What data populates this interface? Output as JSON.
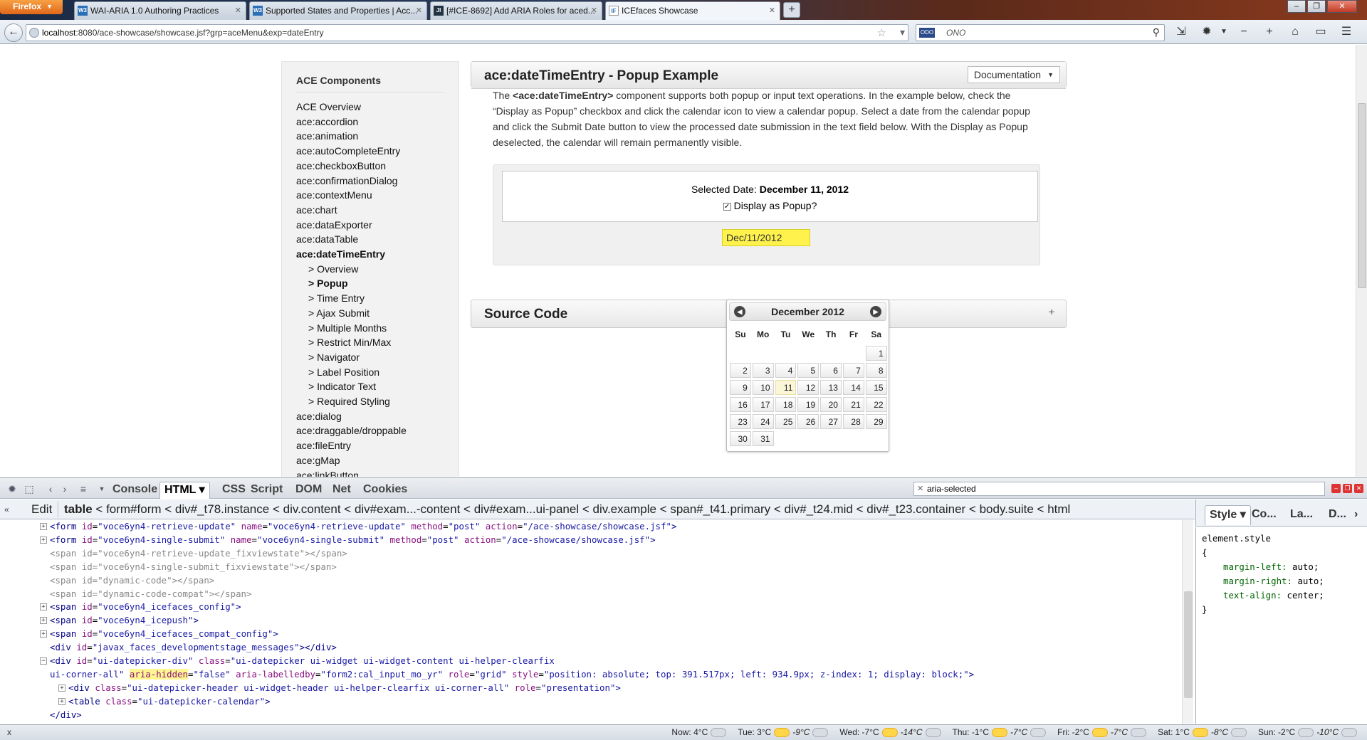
{
  "browser": {
    "menu_label": "Firefox",
    "tabs": [
      {
        "favicon": "W3",
        "label": "WAI-ARIA 1.0 Authoring Practices",
        "active": false
      },
      {
        "favicon": "W3",
        "label": "Supported States and Properties | Acc...",
        "active": false
      },
      {
        "favicon": "JI",
        "label": "[#ICE-8692] Add ARIA Roles for aced...",
        "active": false
      },
      {
        "favicon": "IF",
        "label": "ICEfaces Showcase",
        "active": true
      }
    ],
    "url_host": "localhost",
    "url_rest": ":8080/ace-showcase/showcase.jsf?grp=aceMenu&exp=dateEntry",
    "search_engine": "ODO",
    "search_text": "ONO"
  },
  "sidebar": {
    "title": "ACE Components",
    "items": [
      {
        "label": "ACE Overview",
        "level": 0,
        "bold": false
      },
      {
        "label": "ace:accordion",
        "level": 0,
        "bold": false
      },
      {
        "label": "ace:animation",
        "level": 0,
        "bold": false
      },
      {
        "label": "ace:autoCompleteEntry",
        "level": 0,
        "bold": false
      },
      {
        "label": "ace:checkboxButton",
        "level": 0,
        "bold": false
      },
      {
        "label": "ace:confirmationDialog",
        "level": 0,
        "bold": false
      },
      {
        "label": "ace:contextMenu",
        "level": 0,
        "bold": false
      },
      {
        "label": "ace:chart",
        "level": 0,
        "bold": false
      },
      {
        "label": "ace:dataExporter",
        "level": 0,
        "bold": false
      },
      {
        "label": "ace:dataTable",
        "level": 0,
        "bold": false
      },
      {
        "label": "ace:dateTimeEntry",
        "level": 0,
        "bold": true
      },
      {
        "label": "> Overview",
        "level": 1,
        "bold": false
      },
      {
        "label": "> Popup",
        "level": 1,
        "bold": true
      },
      {
        "label": "> Time Entry",
        "level": 1,
        "bold": false
      },
      {
        "label": "> Ajax Submit",
        "level": 1,
        "bold": false
      },
      {
        "label": "> Multiple Months",
        "level": 1,
        "bold": false
      },
      {
        "label": "> Restrict Min/Max",
        "level": 1,
        "bold": false
      },
      {
        "label": "> Navigator",
        "level": 1,
        "bold": false
      },
      {
        "label": "> Label Position",
        "level": 1,
        "bold": false
      },
      {
        "label": "> Indicator Text",
        "level": 1,
        "bold": false
      },
      {
        "label": "> Required Styling",
        "level": 1,
        "bold": false
      },
      {
        "label": "ace:dialog",
        "level": 0,
        "bold": false
      },
      {
        "label": "ace:draggable/droppable",
        "level": 0,
        "bold": false
      },
      {
        "label": "ace:fileEntry",
        "level": 0,
        "bold": false
      },
      {
        "label": "ace:gMap",
        "level": 0,
        "bold": false
      },
      {
        "label": "ace:linkButton",
        "level": 0,
        "bold": false
      }
    ]
  },
  "main": {
    "title": "ace:dateTimeEntry - Popup Example",
    "doc_button": "Documentation",
    "desc_pre": "The ",
    "desc_bold": "<ace:dateTimeEntry>",
    "desc_post": " component supports both popup or input text operations. In the example below, check the “Display as Popup” checkbox and click the calendar icon to view a calendar popup. Select a date from the calendar popup and click the Submit Date button to view the processed date submission in the text field below. With the Display as Popup deselected, the calendar will remain permanently visible.",
    "selected_label": "Selected Date: ",
    "selected_value": "December 11, 2012",
    "popup_checkbox_label": "Display as Popup?",
    "popup_checked": true,
    "date_input_value": "Dec/11/2012",
    "source_title": "Source Code",
    "source_toggle": "+"
  },
  "datepicker": {
    "month_label": "December 2012",
    "prev": "◀",
    "next": "▶",
    "weekdays": [
      "Su",
      "Mo",
      "Tu",
      "We",
      "Th",
      "Fr",
      "Sa"
    ],
    "weeks": [
      [
        "",
        "",
        "",
        "",
        "",
        "",
        "1"
      ],
      [
        "2",
        "3",
        "4",
        "5",
        "6",
        "7",
        "8"
      ],
      [
        "9",
        "10",
        "11",
        "12",
        "13",
        "14",
        "15"
      ],
      [
        "16",
        "17",
        "18",
        "19",
        "20",
        "21",
        "22"
      ],
      [
        "23",
        "24",
        "25",
        "26",
        "27",
        "28",
        "29"
      ],
      [
        "30",
        "31",
        "",
        "",
        "",
        "",
        ""
      ]
    ],
    "selected_day": "11"
  },
  "firebug": {
    "tabs": [
      "Console",
      "HTML",
      "CSS",
      "Script",
      "DOM",
      "Net",
      "Cookies"
    ],
    "active_tab": "HTML",
    "search_value": "aria-selected",
    "edit_label": "Edit",
    "breadcrumbs": [
      "table",
      "form#form",
      "div#_t78.instance",
      "div.content",
      "div#exam...-content",
      "div#exam...ui-panel",
      "div.example",
      "span#_t41.primary",
      "div#_t24.mid",
      "div#_t23.container",
      "body.suite",
      "html"
    ],
    "side_tabs": [
      "Style",
      "Co...",
      "La...",
      "D..."
    ],
    "style_selector": "element.style",
    "style_open": "{",
    "style_props": [
      "margin-left: auto;",
      "margin-right: auto;",
      "text-align: center;"
    ],
    "style_close": "}"
  },
  "statusbar": {
    "close": "x",
    "weather": [
      {
        "label": "Now: 4°C",
        "icon": "cloud",
        "low": ""
      },
      {
        "label": "Tue: 3°C",
        "icon": "sun-cloud",
        "low": "-9°C"
      },
      {
        "label": "Wed: -7°C",
        "icon": "sun-cloud",
        "low": "-14°C"
      },
      {
        "label": "Thu: -1°C",
        "icon": "sun-cloud",
        "low": "-7°C"
      },
      {
        "label": "Fri: -2°C",
        "icon": "sun-cloud",
        "low": "-7°C"
      },
      {
        "label": "Sat: 1°C",
        "icon": "sun-cloud",
        "low": "-8°C"
      },
      {
        "label": "Sun: -2°C",
        "icon": "cloud",
        "low": "-10°C"
      }
    ]
  },
  "colors": {
    "highlight_input": "#fff24d",
    "aria_highlight": "#fff68f",
    "tag": "#000088",
    "attr_name": "#881280",
    "attr_value": "#1a1aa6"
  }
}
